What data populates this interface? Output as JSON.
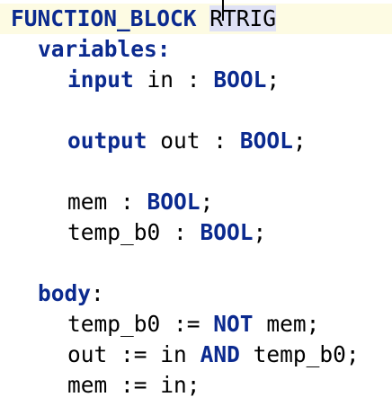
{
  "header": {
    "keyword": "FUNCTION_BLOCK",
    "name_before_caret": "R",
    "name_after_caret": "TRIG"
  },
  "variables_section": {
    "keyword": "variables",
    "colon": ":"
  },
  "declarations": [
    {
      "qualifier": "input",
      "name": "in",
      "sep": " : ",
      "type": "BOOL",
      "end": ";"
    },
    {
      "qualifier": "output",
      "name": "out",
      "sep": " : ",
      "type": "BOOL",
      "end": ";"
    },
    {
      "name": "mem",
      "sep": " : ",
      "type": "BOOL",
      "end": ";"
    },
    {
      "name": "temp_b0",
      "sep": " : ",
      "type": "BOOL",
      "end": ";"
    }
  ],
  "body_section": {
    "keyword": "body",
    "colon": ":"
  },
  "statements": [
    {
      "lhs": "temp_b0",
      "assign": " := ",
      "op": "NOT",
      "rhs": "mem",
      "end": ";"
    },
    {
      "lhs": "out",
      "assign": " := ",
      "left": "in",
      "op": "AND",
      "right": "temp_b0",
      "end": ";"
    },
    {
      "lhs": "mem",
      "assign": " := ",
      "rhs": "in",
      "end": ";"
    }
  ],
  "colors": {
    "keyword": "#0b2a8f",
    "current_line": "#fdfbe3",
    "word_highlight": "#dfe1f5"
  }
}
